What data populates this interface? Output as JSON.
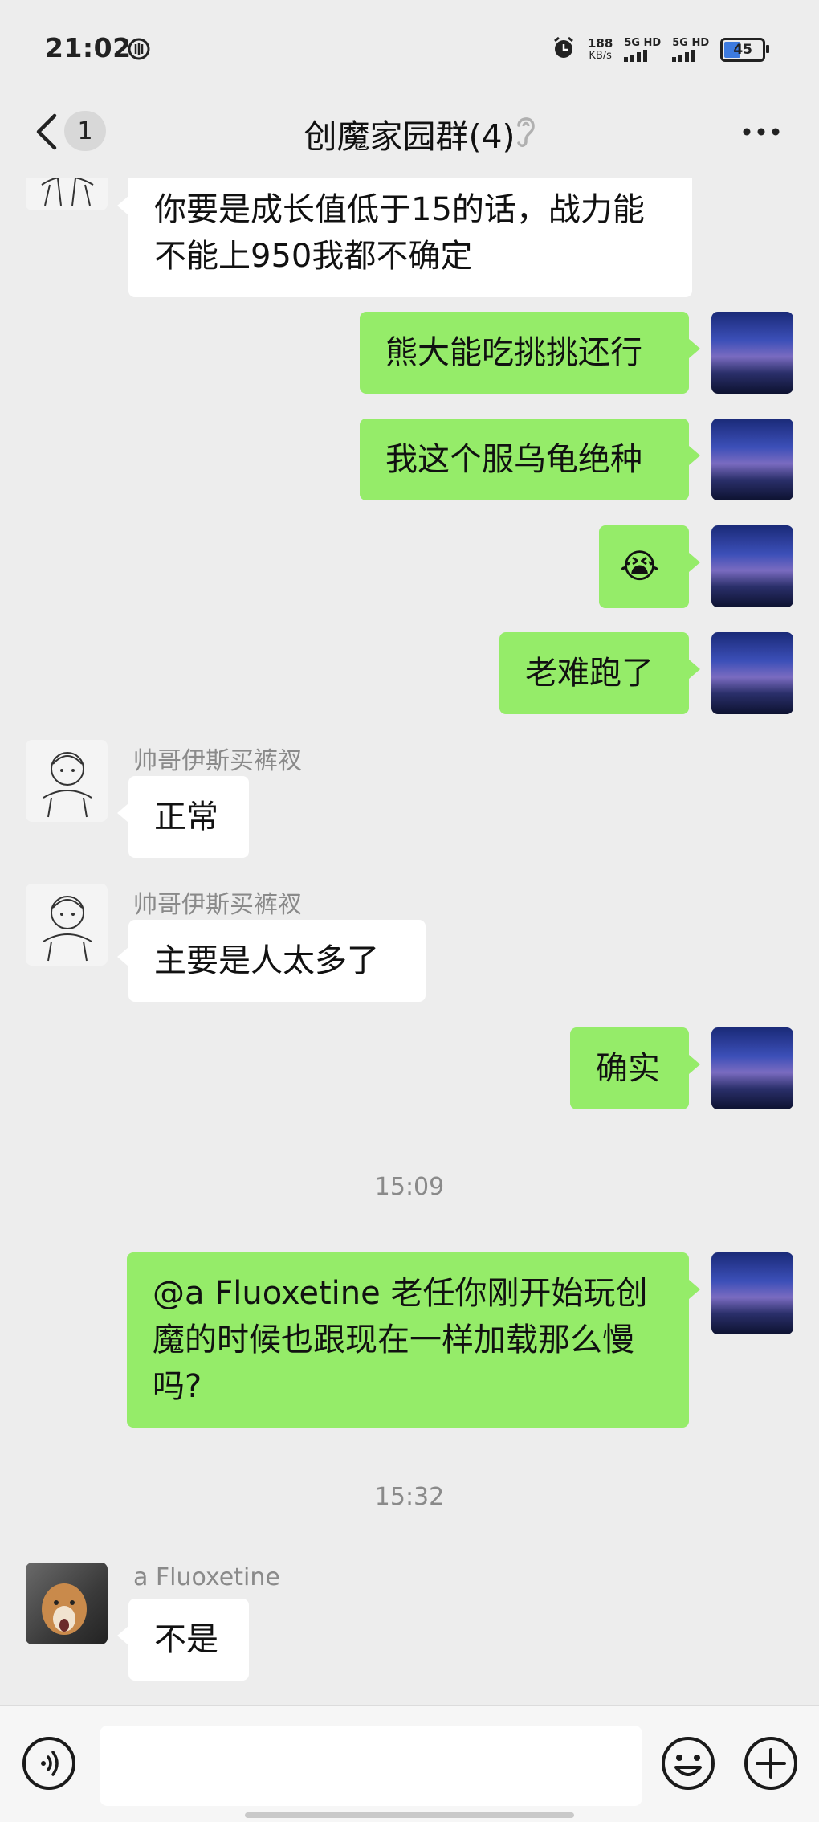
{
  "status_bar": {
    "time": "21:02",
    "speed_value": "188",
    "speed_unit": "KB/s",
    "sim1": "5G HD",
    "sim2": "5G HD",
    "battery": "45"
  },
  "header": {
    "unread_count": "1",
    "title": "创魔家园群(4)"
  },
  "messages": [
    {
      "side": "in",
      "text": "你要是成长值低于15的话，战力能不能上950我都不确定"
    },
    {
      "side": "out",
      "text": "熊大能吃挑挑还行"
    },
    {
      "side": "out",
      "text": "我这个服乌龟绝种"
    },
    {
      "side": "out",
      "text": "😭"
    },
    {
      "side": "out",
      "text": "老难跑了"
    },
    {
      "side": "in",
      "sender": "帅哥伊斯买裤衩",
      "text": "正常"
    },
    {
      "side": "in",
      "sender": "帅哥伊斯买裤衩",
      "text": "主要是人太多了"
    },
    {
      "side": "out",
      "text": "确实"
    },
    {
      "timestamp": "15:09"
    },
    {
      "side": "out",
      "text": "@a Fluoxetine 老任你刚开始玩创魔的时候也跟现在一样加载那么慢吗?"
    },
    {
      "timestamp": "15:32"
    },
    {
      "side": "in",
      "sender": "a Fluoxetine",
      "text": "不是"
    }
  ],
  "icons": [
    "back-chevron-icon",
    "hearing-mode-icon",
    "more-icon",
    "voice-icon",
    "emoji-icon",
    "plus-icon",
    "alarm-icon",
    "data-saver-icon"
  ],
  "colors": {
    "background": "#ededed",
    "bubble_out": "#95ec69",
    "bubble_in": "#ffffff",
    "meta_text": "#8a8a8a"
  }
}
